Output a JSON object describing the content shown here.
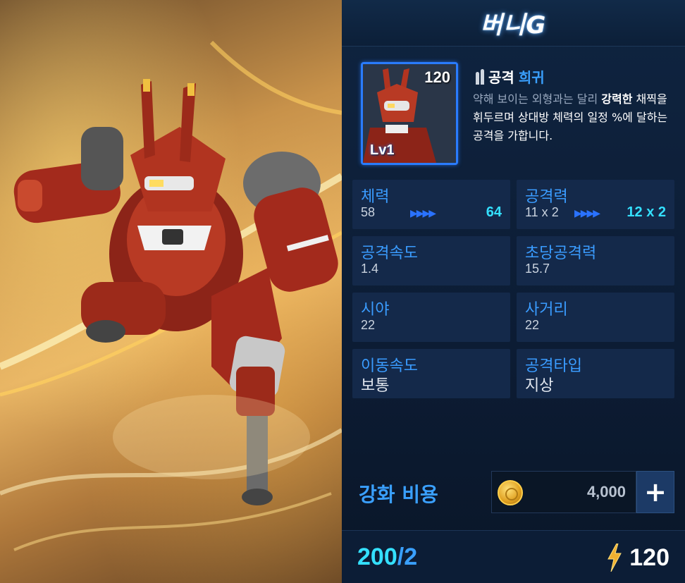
{
  "unit": {
    "name": "버니G",
    "cost": "120",
    "level": "Lv1",
    "attack_type_label": "공격",
    "rarity": "희귀",
    "description_dim": "약해 보이는 외형과는 달리 ",
    "description_strong": "강력한",
    "description_rest": " 채찍을 휘두르며 상대방 체력의 일정 %에 달하는 공격을 가합니다."
  },
  "stats": [
    {
      "label": "체력",
      "value": "58",
      "arrows": "▶▶▶▶",
      "next": "64"
    },
    {
      "label": "공격력",
      "value": "11 x 2",
      "arrows": "▶▶▶▶",
      "next": "12 x 2"
    },
    {
      "label": "공격속도",
      "value": "1.4"
    },
    {
      "label": "초당공격력",
      "value": "15.7"
    },
    {
      "label": "시야",
      "value": "22"
    },
    {
      "label": "사거리",
      "value": "22"
    },
    {
      "label": "이동속도",
      "value": "보통"
    },
    {
      "label": "공격타입",
      "value": "지상"
    }
  ],
  "upgrade": {
    "label": "강화 비용",
    "cost": "4,000",
    "plus": "+",
    "currency_icon": "gold-coin-icon"
  },
  "footer": {
    "count_current": "200",
    "count_sep": "/",
    "count_max": "2",
    "energy_icon": "lightning-bolt-icon",
    "energy_value": "120"
  },
  "colors": {
    "accent_blue": "#3aa0ff",
    "cyan": "#34e0ff",
    "panel_bg": "#0f2440",
    "stat_bg": "#14294a"
  }
}
